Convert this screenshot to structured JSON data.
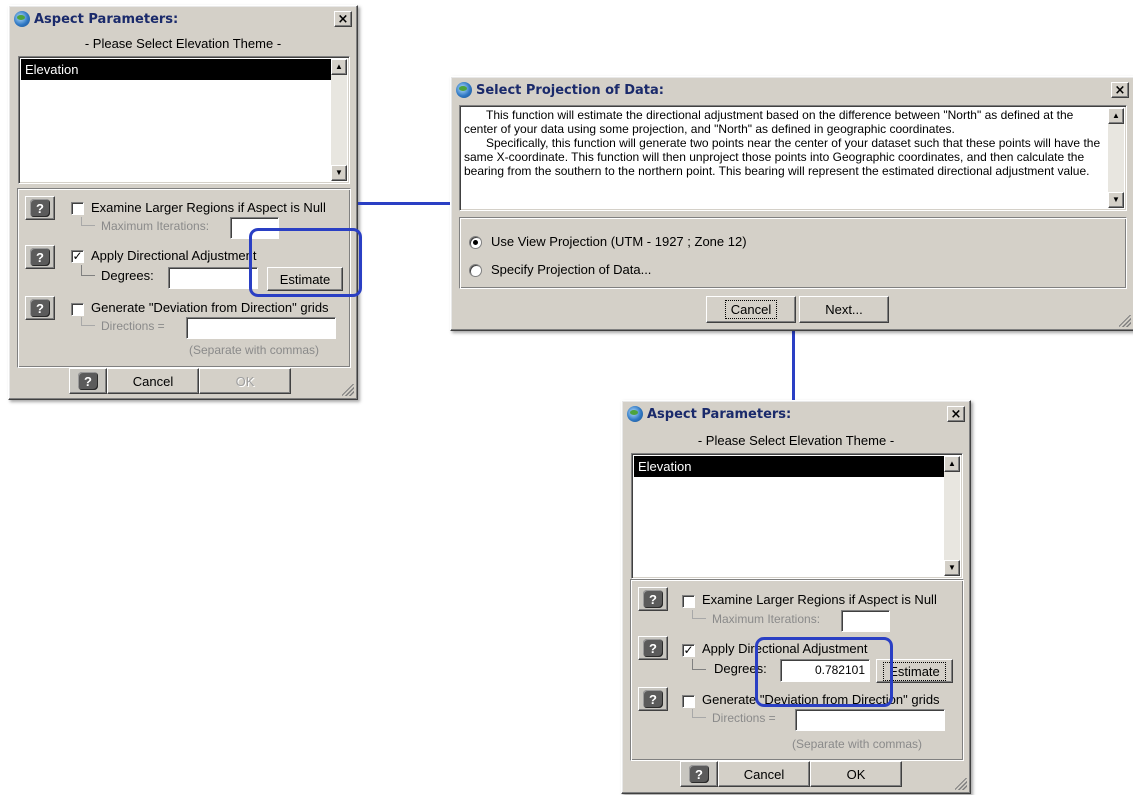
{
  "aspect_dialog_before": {
    "title": "Aspect Parameters:",
    "close_glyph": "×",
    "prompt": "- Please Select Elevation Theme -",
    "themes": [
      "Elevation"
    ],
    "examine_label": "Examine Larger Regions if Aspect is Null",
    "max_iterations_label": "Maximum Iterations:",
    "max_iterations_value": "",
    "apply_label": "Apply Directional Adjustment",
    "apply_checked": true,
    "degrees_label": "Degrees:",
    "degrees_value": "",
    "estimate_label": "Estimate",
    "generate_label": "Generate \"Deviation from Direction\" grids",
    "directions_label": "Directions =",
    "directions_value": "",
    "separate_hint": "(Separate with commas)",
    "help_glyph": "?",
    "cancel_label": "Cancel",
    "ok_label": "OK"
  },
  "projection_dialog": {
    "title": "Select Projection of Data:",
    "close_glyph": "×",
    "description_1": "This function will estimate the directional adjustment based on the difference between \"North\" as defined at the center of your data using some projection, and \"North\" as defined in geographic coordinates.",
    "description_2": "Specifically, this function will generate two points near the center of your dataset such that these points will have the same X-coordinate.  This function will then unproject those points into Geographic coordinates, and then calculate the bearing from the southern to the northern point.  This bearing will represent the estimated directional adjustment value.",
    "options": [
      {
        "label": "Use View Projection (UTM - 1927 ; Zone 12)",
        "selected": true
      },
      {
        "label": "Specify Projection of Data...",
        "selected": false
      }
    ],
    "cancel_label": "Cancel",
    "next_label": "Next..."
  },
  "aspect_dialog_after": {
    "title": "Aspect Parameters:",
    "close_glyph": "×",
    "prompt": "- Please Select Elevation Theme -",
    "themes": [
      "Elevation"
    ],
    "examine_label": "Examine Larger Regions if Aspect is Null",
    "max_iterations_label": "Maximum Iterations:",
    "max_iterations_value": "",
    "apply_label": "Apply Directional Adjustment",
    "apply_checked": true,
    "degrees_label": "Degrees:",
    "degrees_value": "0.782101",
    "estimate_label": "Estimate",
    "generate_label": "Generate \"Deviation from Direction\" grids",
    "directions_label": "Directions =",
    "directions_value": "",
    "separate_hint": "(Separate with commas)",
    "help_glyph": "?",
    "cancel_label": "Cancel",
    "ok_label": "OK"
  },
  "colors": {
    "dialog_face": "#d4d0c8",
    "highlight_blue": "#2a3fc4",
    "title_text": "#1a2a6b"
  }
}
